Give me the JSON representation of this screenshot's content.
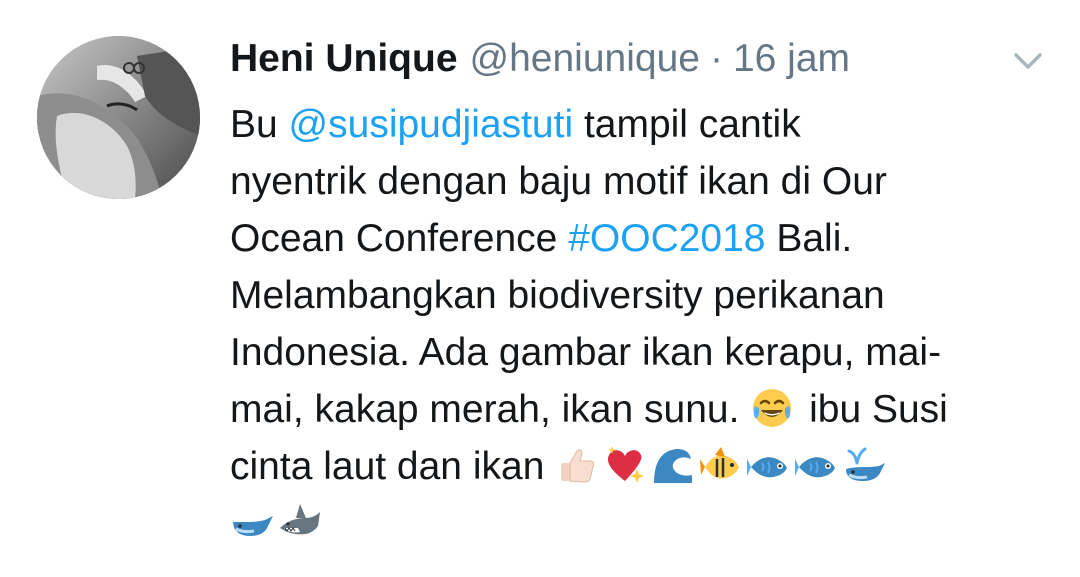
{
  "tweet": {
    "author_name": "Heni Unique",
    "handle": "@heniunique",
    "separator": "·",
    "time": "16 jam",
    "text": {
      "l1_a": "Bu ",
      "mention": "@susipudjiastuti",
      "l1_b": " tampil cantik",
      "l2": "nyentrik dengan baju motif ikan di Our",
      "l3_a": "Ocean Conference ",
      "hashtag": "#OOC2018",
      "l3_b": " Bali.",
      "l4": "Melambangkan biodiversity perikanan",
      "l5": "Indonesia. Ada gambar ikan kerapu, mai-",
      "l6_a": "mai, kakap merah, ikan sunu. ",
      "l6_b": " ibu Susi",
      "l7": "cinta laut dan ikan "
    },
    "emojis": [
      "face-with-tears-of-joy",
      "thumbs-up-light-skin",
      "sparkling-heart",
      "water-wave",
      "tropical-fish",
      "fish",
      "fish",
      "spouting-whale",
      "whale",
      "shark"
    ]
  },
  "colors": {
    "link": "#1da1f2",
    "text": "#14171a",
    "secondary": "#657786"
  }
}
